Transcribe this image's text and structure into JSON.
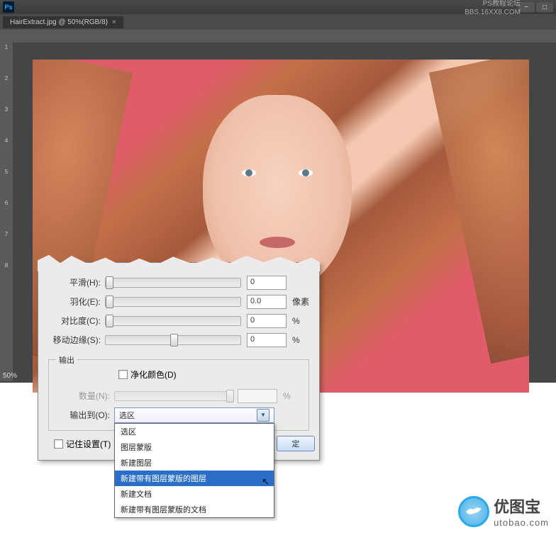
{
  "title_bar": {
    "app_icon": "Ps"
  },
  "watermark_top": {
    "line1": "PS教程论坛",
    "line2": "BBS.16XX8.COM"
  },
  "tab": {
    "label": "HairExtract.jpg @ 50%(RGB/8)",
    "close": "×"
  },
  "zoom": "50%",
  "adjust": {
    "smooth": {
      "label": "平滑(H):",
      "value": "0",
      "thumb_pct": 0
    },
    "feather": {
      "label": "羽化(E):",
      "value": "0.0",
      "unit": "像素",
      "thumb_pct": 0
    },
    "contrast": {
      "label": "对比度(C):",
      "value": "0",
      "unit": "%",
      "thumb_pct": 0
    },
    "shift_edge": {
      "label": "移动边缘(S):",
      "value": "0",
      "unit": "%",
      "thumb_pct": 48
    }
  },
  "output": {
    "legend": "输出",
    "decontaminate": "净化颜色(D)",
    "amount_label": "数量(N):",
    "amount_unit": "%",
    "output_to_label": "输出到(O):",
    "selected": "选区",
    "options": [
      "选区",
      "图层蒙版",
      "新建图层",
      "新建带有图层蒙版的图层",
      "新建文档",
      "新建带有图层蒙版的文档"
    ],
    "highlight_index": 3
  },
  "remember": "记住设置(T)",
  "ok": "定",
  "logo": {
    "main": "优图宝",
    "sub": "utobao",
    "tld": ".com"
  }
}
